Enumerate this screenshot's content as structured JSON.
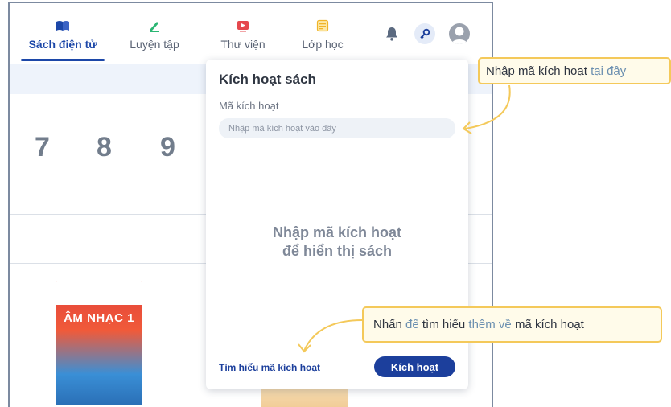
{
  "nav": {
    "tabs": [
      {
        "label": "Sách điện tử",
        "icon": "book-icon"
      },
      {
        "label": "Luyện tập",
        "icon": "pencil-icon"
      },
      {
        "label": "Thư viện",
        "icon": "video-icon"
      },
      {
        "label": "Lớp học",
        "icon": "notes-icon"
      }
    ],
    "active_tab": "Sách điện tử",
    "right_icons": [
      "bell-icon",
      "key-icon",
      "avatar-icon"
    ]
  },
  "background": {
    "numbers": [
      "7",
      "8",
      "9"
    ],
    "book_title": "ÂM NHẠC 1"
  },
  "panel": {
    "title": "Kích hoạt sách",
    "field_label": "Mã kích hoạt",
    "input_value": "",
    "input_placeholder": "Nhập mã kích hoạt vào đây",
    "empty_line1": "Nhập mã kích hoạt",
    "empty_line2": "để hiển thị sách",
    "learn_link": "Tìm hiểu mã kích hoạt",
    "activate_button": "Kích hoạt"
  },
  "callouts": {
    "top": {
      "part1": "Nhập mã kích hoạt",
      "part2": "tại đây"
    },
    "bottom": {
      "part1": "Nhấn",
      "part2": "để",
      "part3": "tìm hiểu",
      "part4": "thêm về",
      "part5": "mã kích hoạt"
    }
  },
  "colors": {
    "brand_blue": "#1c3f9c",
    "active_tab": "#1c47a8",
    "callout_border": "#f4c95a",
    "callout_bg": "#fffbea"
  }
}
